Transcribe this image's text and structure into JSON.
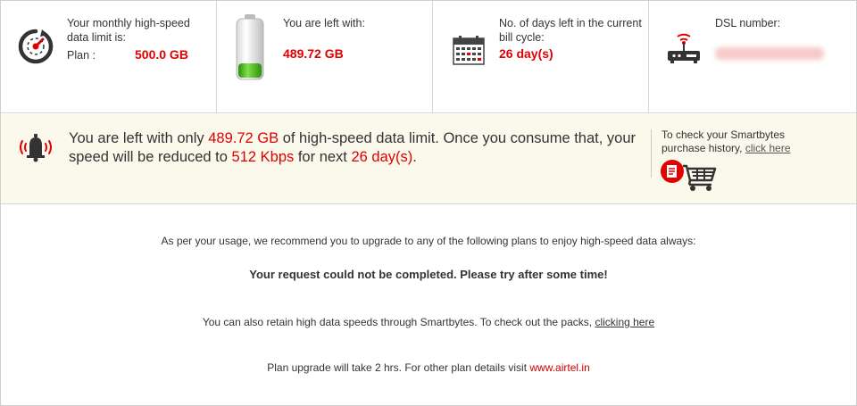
{
  "stats": {
    "limit": {
      "icon": "speedometer-icon",
      "label": "Your monthly high-speed data limit is:",
      "plan_label": "Plan :",
      "value": "500.0 GB"
    },
    "remaining": {
      "icon": "battery-icon",
      "label": "You are left with:",
      "value": "489.72 GB"
    },
    "days": {
      "icon": "calendar-icon",
      "label": "No. of days left in the current bill cycle:",
      "value": "26 day(s)"
    },
    "dsl": {
      "icon": "router-icon",
      "label": "DSL number:"
    }
  },
  "alert": {
    "icon": "bell-icon",
    "part1": "You are left with only ",
    "remaining": "489.72 GB",
    "part2": " of high-speed data limit. Once you consume that, your speed will be reduced to ",
    "speed": "512 Kbps",
    "part3": " for next ",
    "days": "26 day(s)",
    "part4": ".",
    "smartbytes_text": "To check your Smartbytes purchase history, ",
    "smartbytes_link": "click here",
    "cart_icon": "cart-icon"
  },
  "body": {
    "recommend": "As per your usage, we recommend you to upgrade to any of the following plans to enjoy high-speed data always:",
    "error": "Your request could not be completed. Please try after some time!",
    "retain_text": "You can also retain high data speeds through Smartbytes. To check out the packs, ",
    "retain_link": "clicking here",
    "upgrade_text": "Plan upgrade will take 2 hrs. For other plan details visit ",
    "upgrade_link": "www.airtel.in"
  },
  "colors": {
    "accent_red": "#e00000",
    "alert_bg": "#fbf8ec",
    "battery_green": "#3fb21f"
  }
}
